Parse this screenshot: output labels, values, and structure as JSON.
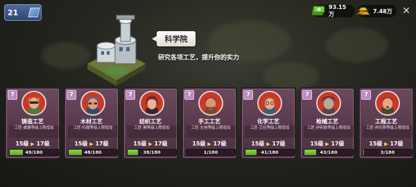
{
  "player": {
    "level": "21"
  },
  "resources": [
    {
      "name": "money",
      "value": "93.15万",
      "icon": "cash-stack-icon",
      "color": "#6fbf3a"
    },
    {
      "name": "gold",
      "value": "7.48万",
      "icon": "gold-bars-icon",
      "color": "#f2c531"
    }
  ],
  "building": {
    "name": "科学院",
    "description": "研究各项工艺，提升你的实力"
  },
  "crafts": [
    {
      "level": "7",
      "title": "铸造工艺",
      "desc": "工匠-威廉等级上限增加",
      "from": "15级",
      "to": "17级",
      "progress_text": "49/180",
      "progress": 0.272,
      "ring_color": "#c7392b",
      "hair": "#e8c53a",
      "skin": "#e2b08a",
      "shirt": "#4e7a3a"
    },
    {
      "level": "7",
      "title": "木材工艺",
      "desc": "工匠-约翰等级上限增加",
      "from": "15级",
      "to": "17级",
      "progress_text": "48/180",
      "progress": 0.267,
      "ring_color": "#c7392b",
      "hair": "#3d6fae",
      "skin": "#d8a07a",
      "shirt": "#2d4d73"
    },
    {
      "level": "7",
      "title": "纺织工艺",
      "desc": "工匠-琳等级上限增加",
      "from": "15级",
      "to": "17级",
      "progress_text": "38/180",
      "progress": 0.211,
      "ring_color": "#c7392b",
      "hair": "#7a2a24",
      "skin": "#e5b69a",
      "shirt": "#2e2a3a"
    },
    {
      "level": "7",
      "title": "手工工艺",
      "desc": "工匠-左纳等级上限增加",
      "from": "15级",
      "to": "17级",
      "progress_text": "1/180",
      "progress": 0.006,
      "ring_color": "#c7392b",
      "hair": "#6b3a1f",
      "skin": "#d59a74",
      "shirt": "#7a4a2e"
    },
    {
      "level": "7",
      "title": "化学工艺",
      "desc": "工匠-艾拉等级上限增加",
      "from": "15级",
      "to": "17级",
      "progress_text": "41/180",
      "progress": 0.228,
      "ring_color": "#c7392b",
      "hair": "#a06a3a",
      "skin": "#e2b08a",
      "shirt": "#3c5e7a"
    },
    {
      "level": "7",
      "title": "枪械工艺",
      "desc": "工匠-伊利欧等级上限增加",
      "from": "15级",
      "to": "17级",
      "progress_text": "43/180",
      "progress": 0.239,
      "ring_color": "#c7392b",
      "hair": "#3a3a3a",
      "skin": "#d8a07a",
      "shirt": "#4a4a56"
    },
    {
      "level": "7",
      "title": "工程工艺",
      "desc": "工匠-邦伦斯等级上限增加",
      "from": "15级",
      "to": "17级",
      "progress_text": "3/180",
      "progress": 0.017,
      "ring_color": "#c7392b",
      "hair": "#5a3a22",
      "skin": "#e0a982",
      "shirt": "#3e4a2e"
    }
  ]
}
